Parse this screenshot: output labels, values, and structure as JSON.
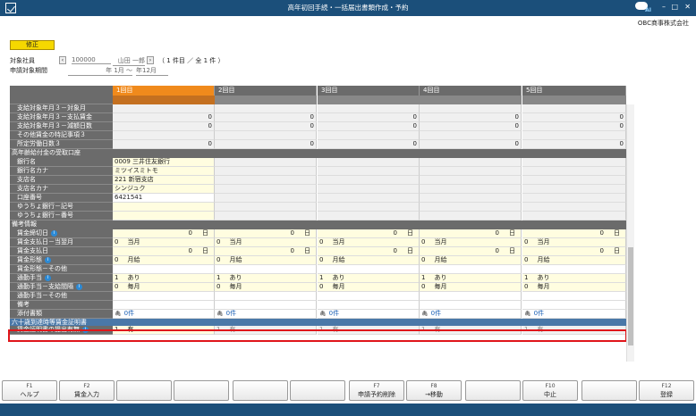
{
  "window": {
    "title": "高年初回手続・一括届出書類作成・予約",
    "company": "OBC商事株式会社",
    "ai_badge": "AI"
  },
  "mode_button": "修正",
  "header": {
    "target_label": "対象社員",
    "emp_code": "100000",
    "emp_name": "山田 一郎",
    "count_text": "（ 1 件目 ／ 全 1 件 ）",
    "period_label": "申請対象期間",
    "period_from": "年 1月 ～",
    "period_to": "年12月"
  },
  "columns": [
    "1回目",
    "2回目",
    "3回目",
    "4回目",
    "5回目"
  ],
  "rows": [
    {
      "label": "支給対象年月３－対象月",
      "type": "data",
      "vals": [
        "",
        "",
        "",
        "",
        ""
      ],
      "style": "gray"
    },
    {
      "label": "支給対象年月３－支払賃金",
      "type": "data",
      "vals": [
        "0",
        "0",
        "0",
        "0",
        "0"
      ],
      "style": "gray",
      "num": true
    },
    {
      "label": "支給対象年月３－減額日数",
      "type": "data",
      "vals": [
        "0",
        "0",
        "0",
        "0",
        "0"
      ],
      "style": "gray",
      "num": true
    },
    {
      "label": "その他賃金の特記事項３",
      "type": "data",
      "vals": [
        "",
        "",
        "",
        "",
        ""
      ],
      "style": "gray"
    },
    {
      "label": "所定労働日数３",
      "type": "data",
      "vals": [
        "0",
        "0",
        "0",
        "0",
        "0"
      ],
      "style": "gray",
      "num": true
    },
    {
      "label": "高年齢給付金の受取口座",
      "type": "section"
    },
    {
      "label": "銀行名",
      "type": "bank",
      "vals": [
        "0009 三井住友銀行",
        "",
        "",
        "",
        ""
      ]
    },
    {
      "label": "銀行名カナ",
      "type": "bank",
      "vals": [
        "ミツイスミトモ",
        "",
        "",
        "",
        ""
      ]
    },
    {
      "label": "支店名",
      "type": "bank",
      "vals": [
        "221 新宿支店",
        "",
        "",
        "",
        ""
      ]
    },
    {
      "label": "支店名カナ",
      "type": "bank",
      "vals": [
        "シンジュク",
        "",
        "",
        "",
        ""
      ]
    },
    {
      "label": "口座番号",
      "type": "bank",
      "vals": [
        "6421541",
        "",
        "",
        "",
        ""
      ],
      "white": true
    },
    {
      "label": "ゆうちょ銀行－記号",
      "type": "bank",
      "vals": [
        "",
        "",
        "",
        "",
        ""
      ]
    },
    {
      "label": "ゆうちょ銀行－番号",
      "type": "bank",
      "vals": [
        "",
        "",
        "",
        "",
        ""
      ]
    },
    {
      "label": "備考情報",
      "type": "section"
    },
    {
      "label": "賃金締切日",
      "type": "unit",
      "info": true,
      "vals": [
        "0",
        "0",
        "0",
        "0",
        "0"
      ],
      "unit": "日"
    },
    {
      "label": "賃金支払日－当翌月",
      "type": "pair",
      "vals": [
        "0",
        "0",
        "0",
        "0",
        "0"
      ],
      "text": "当月"
    },
    {
      "label": "賃金支払日",
      "type": "unit",
      "vals": [
        "0",
        "0",
        "0",
        "0",
        "0"
      ],
      "unit": "日"
    },
    {
      "label": "賃金形態",
      "type": "pair",
      "info": true,
      "vals": [
        "0",
        "0",
        "0",
        "0",
        "0"
      ],
      "text": "月給"
    },
    {
      "label": "賃金形態－その他",
      "type": "data",
      "vals": [
        "",
        "",
        "",
        "",
        ""
      ],
      "style": "white"
    },
    {
      "label": "通勤手当",
      "type": "pair",
      "info": true,
      "vals": [
        "1",
        "1",
        "1",
        "1",
        "1"
      ],
      "text": "あり"
    },
    {
      "label": "通勤手当－支給間隔",
      "type": "pair",
      "info": true,
      "vals": [
        "0",
        "0",
        "0",
        "0",
        "0"
      ],
      "text": "毎月"
    },
    {
      "label": "通勤手当－その他",
      "type": "data",
      "vals": [
        "",
        "",
        "",
        "",
        ""
      ],
      "style": "white"
    },
    {
      "label": "備考",
      "type": "data",
      "vals": [
        "",
        "",
        "",
        "",
        ""
      ],
      "style": "white"
    },
    {
      "label": "添付書類",
      "type": "attach",
      "vals": [
        "0件",
        "0件",
        "0件",
        "0件",
        "0件"
      ]
    },
    {
      "label": "六十歳到達時等賃金証明書",
      "type": "blue"
    },
    {
      "label": "賃金証明書の提出有無",
      "type": "pair",
      "info": true,
      "vals": [
        "1",
        "1",
        "1",
        "1",
        "1"
      ],
      "text": "有",
      "dimrest": true
    }
  ],
  "fkeys": [
    {
      "key": "F1",
      "label": "ヘルプ"
    },
    {
      "key": "F2",
      "label": "賃金入力"
    },
    {
      "key": "",
      "label": ""
    },
    {
      "key": "",
      "label": ""
    },
    {
      "key": "",
      "label": ""
    },
    {
      "key": "",
      "label": ""
    },
    {
      "key": "F7",
      "label": "申請予約削除"
    },
    {
      "key": "F8",
      "label": "→移動"
    },
    {
      "key": "",
      "label": ""
    },
    {
      "key": "F10",
      "label": "中止"
    },
    {
      "key": "",
      "label": ""
    },
    {
      "key": "F12",
      "label": "登録"
    }
  ],
  "colors": {
    "titlebar": "#1b4f7a",
    "accent": "#f08a1c",
    "label_bg": "#6b6b6b",
    "highlight": "#e0151a"
  }
}
